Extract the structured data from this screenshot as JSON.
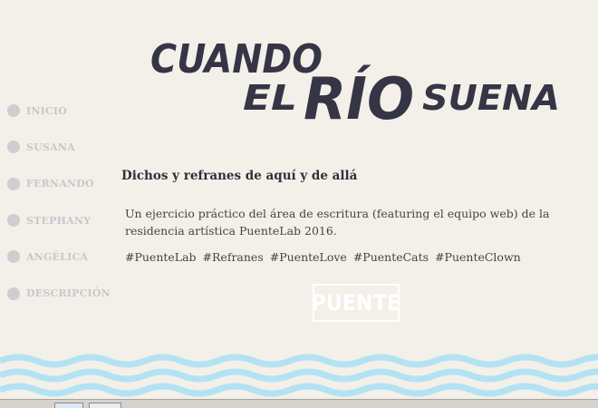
{
  "logo": {
    "line1": "CUANDO",
    "line2_left": "EL",
    "line2_middle": "RÍO",
    "line2_right": "SUENA",
    "color": "#353546"
  },
  "sidebar": {
    "items": [
      {
        "label": "INICIO"
      },
      {
        "label": "SUSANA"
      },
      {
        "label": "FERNANDO"
      },
      {
        "label": "STEPHANY"
      },
      {
        "label": "ANGÉLICA"
      },
      {
        "label": "DESCRIPCIÓN"
      }
    ],
    "dot_color": "#cfcdd0"
  },
  "main": {
    "heading": "Dichos y refranes de aquí y de allá",
    "description": "Un ejercicio práctico del área de escritura (featuring el equipo web) de la residencia artística PuenteLab 2016.",
    "hashtags": [
      "#PuenteLab",
      "#Refranes",
      "#PuenteLove",
      "#PuenteCats",
      "#PuenteClown"
    ],
    "badge": "PUENTE"
  },
  "colors": {
    "background": "#f3f0e9",
    "wave": "#b3e2f4",
    "text": "#444444"
  }
}
